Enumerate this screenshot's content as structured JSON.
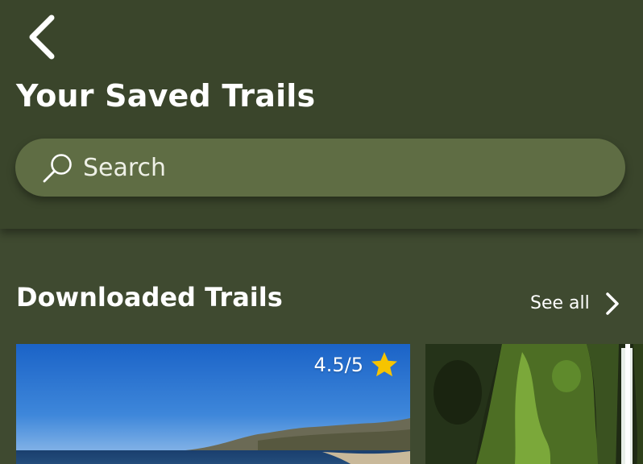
{
  "header": {
    "back_icon": "chevron-left-icon",
    "title": "Your Saved Trails"
  },
  "search": {
    "icon": "search-icon",
    "placeholder": "Search",
    "value": ""
  },
  "downloaded_section": {
    "title": "Downloaded Trails",
    "see_all_label": "See all",
    "see_all_icon": "chevron-right-icon",
    "trails": [
      {
        "rating": "4.5/5",
        "rating_icon": "star-icon",
        "image": "coastal-beach-photo"
      },
      {
        "image": "mossy-waterfall-photo"
      }
    ]
  },
  "colors": {
    "header_bg": "#3a452b",
    "page_bg": "#3f4a30",
    "search_bg": "#5f6d44",
    "star": "#f6c400",
    "text": "#ffffff"
  }
}
